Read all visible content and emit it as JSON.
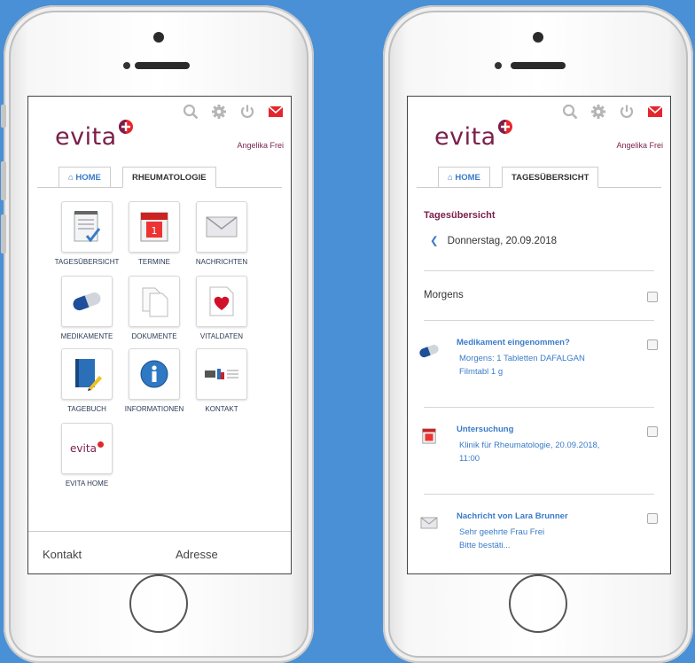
{
  "colors": {
    "background": "#4a90d6",
    "brand": "#7a1f4a",
    "accent": "#3a7bc8",
    "mail": "#e4262c"
  },
  "left_screen": {
    "logo": "evita",
    "user_name": "Angelika Frei",
    "tabs": [
      "HOME",
      "RHEUMATOLOGIE"
    ],
    "tiles": [
      {
        "label": "TAGESÜBERSICHT",
        "icon": "checklist-icon"
      },
      {
        "label": "TERMINE",
        "icon": "calendar-icon"
      },
      {
        "label": "NACHRICHTEN",
        "icon": "envelope-icon"
      },
      {
        "label": "MEDIKAMENTE",
        "icon": "capsule-icon"
      },
      {
        "label": "DOKUMENTE",
        "icon": "documents-icon"
      },
      {
        "label": "VITALDATEN",
        "icon": "heart-icon"
      },
      {
        "label": "TAGEBUCH",
        "icon": "diary-icon"
      },
      {
        "label": "INFORMATIONEN",
        "icon": "info-icon"
      },
      {
        "label": "KONTAKT",
        "icon": "contact-logo-icon"
      },
      {
        "label": "EVITA HOME",
        "icon": "evita-logo-icon",
        "tile_text": "evita"
      }
    ],
    "footer": {
      "kontakt": "Kontakt",
      "adresse": "Adresse"
    }
  },
  "right_screen": {
    "logo": "evita",
    "user_name": "Angelika Frei",
    "tabs": [
      "HOME",
      "TAGESÜBERSICHT"
    ],
    "heading": "Tagesübersicht",
    "date": "Donnerstag, 20.09.2018",
    "section": "Morgens",
    "entries": [
      {
        "title": "Medikament eingenommen?",
        "line1": "Morgens: 1 Tabletten DAFALGAN",
        "line2": "Filmtabl 1 g",
        "icon": "capsule-icon"
      },
      {
        "title": "Untersuchung",
        "line1": "Klinik für Rheumatologie, 20.09.2018,",
        "line2": "11:00",
        "icon": "calendar-icon"
      },
      {
        "title": "Nachricht von Lara Brunner",
        "line1": "Sehr geehrte Frau Frei",
        "line2": "Bitte bestäti...",
        "icon": "envelope-icon"
      }
    ]
  }
}
